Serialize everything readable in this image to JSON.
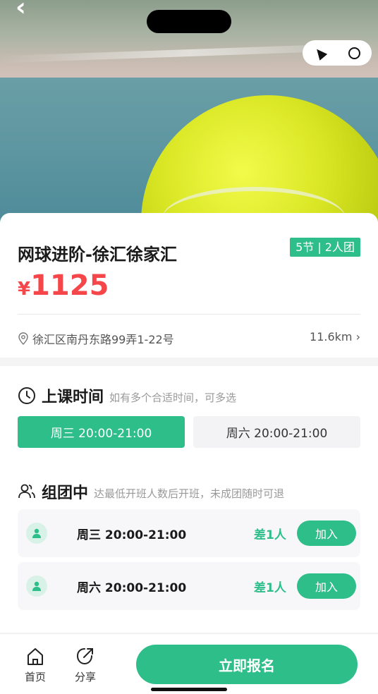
{
  "course": {
    "title": "网球进阶-徐汇徐家汇",
    "tag": "5节 | 2人团",
    "currency": "¥",
    "price": "1125",
    "address": "徐汇区南丹东路99弄1-22号",
    "distance": "11.6km ›"
  },
  "schedule": {
    "heading": "上课时间",
    "hint": "如有多个合适时间，可多选",
    "slots": [
      {
        "label": "周三 20:00-21:00",
        "selected": true
      },
      {
        "label": "周六 20:00-21:00",
        "selected": false
      }
    ]
  },
  "groups": {
    "heading": "组团中",
    "hint": "达最低开班人数后开班，未成团随时可退",
    "rows": [
      {
        "time": "周三 20:00-21:00",
        "need": "差1人",
        "join": "加入"
      },
      {
        "time": "周六 20:00-21:00",
        "need": "差1人",
        "join": "加入"
      }
    ]
  },
  "bottom": {
    "home": "首页",
    "share": "分享",
    "cta": "立即报名"
  },
  "colors": {
    "accent": "#2ebe8a",
    "price": "#f5464a"
  },
  "icons": [
    "back-icon",
    "navigation-icon",
    "close-circle-icon",
    "location-pin-icon",
    "clock-icon",
    "users-icon",
    "user-avatar-icon",
    "home-icon",
    "share-icon"
  ]
}
